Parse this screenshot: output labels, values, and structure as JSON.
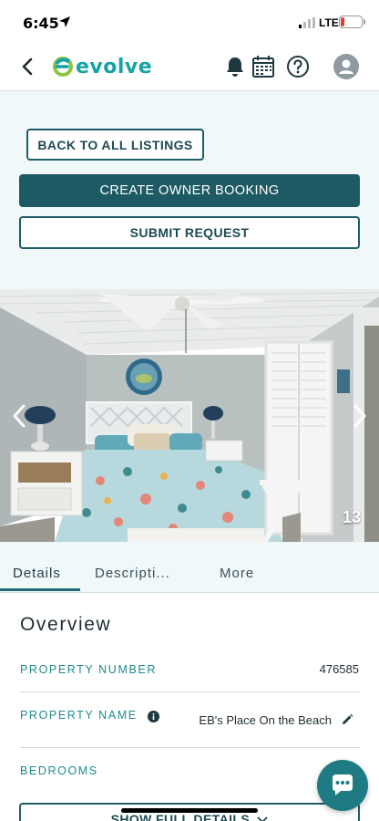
{
  "status_bar": {
    "time": "6:45",
    "network": "LTE",
    "battery_color": "#e53935"
  },
  "header": {
    "logo_text": "evolve",
    "icons": [
      "back-chevron-icon",
      "bell-icon",
      "calendar-icon",
      "help-icon",
      "user-avatar-icon"
    ],
    "brand_color": "#17a3a3"
  },
  "actions": {
    "back_label": "BACK TO ALL LISTINGS",
    "owner_booking_label": "CREATE OWNER BOOKING",
    "submit_request_label": "SUBMIT REQUEST",
    "primary_color": "#1e5a63"
  },
  "photo": {
    "count": "13"
  },
  "tabs": [
    {
      "label": "Details",
      "active": true
    },
    {
      "label": "Descripti...",
      "active": false
    },
    {
      "label": "More",
      "active": false
    }
  ],
  "overview": {
    "title": "Overview",
    "rows": [
      {
        "label": "PROPERTY NUMBER",
        "value": "476585"
      },
      {
        "label": "PROPERTY NAME",
        "value": "EB's Place On the Beach"
      },
      {
        "label": "BEDROOMS",
        "value": ""
      }
    ],
    "show_full_label": "SHOW FULL DETAILS"
  }
}
